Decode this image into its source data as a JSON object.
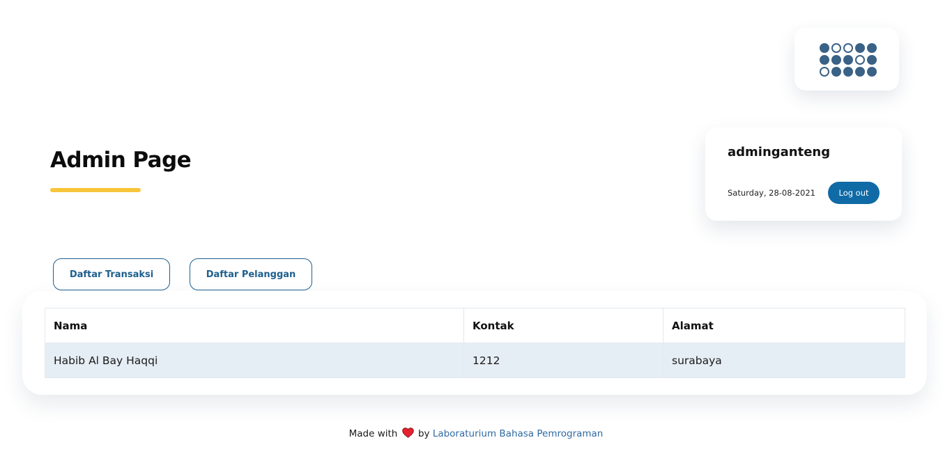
{
  "header": {
    "logo_icon": "dot-grid-logo-icon",
    "accent_color": "#3a6186",
    "logo_pattern": [
      [
        1,
        0,
        0,
        1,
        1
      ],
      [
        1,
        1,
        1,
        0,
        1
      ],
      [
        0,
        1,
        1,
        1,
        1
      ]
    ]
  },
  "page": {
    "title": "Admin Page",
    "underline_color": "#f8c53a"
  },
  "user": {
    "username": "adminganteng",
    "date": "Saturday, 28-08-2021",
    "logout_label": "Log out",
    "logout_color": "#0f6aa6"
  },
  "nav": {
    "transaksi_label": "Daftar Transaksi",
    "pelanggan_label": "Daftar Pelanggan"
  },
  "table": {
    "columns": [
      "Nama",
      "Kontak",
      "Alamat"
    ],
    "rows": [
      [
        "Habib Al Bay Haqqi",
        "1212",
        "surabaya"
      ]
    ]
  },
  "footer": {
    "prefix": "Made with",
    "heart_icon": "heart-icon",
    "by": "by",
    "link_text": "Laboraturium Bahasa Pemrograman",
    "link_color": "#2f6aa1"
  }
}
